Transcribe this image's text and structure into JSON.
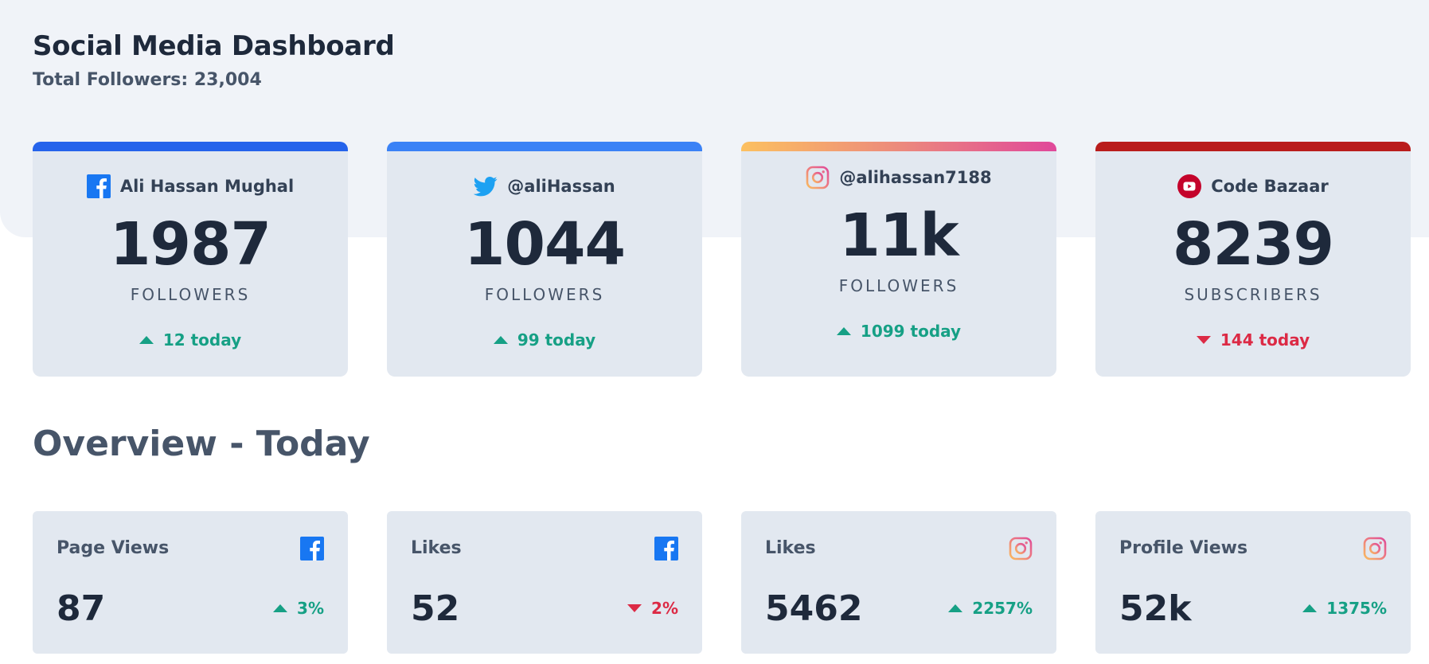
{
  "header": {
    "title": "Social Media Dashboard",
    "subtitle": "Total Followers: 23,004"
  },
  "colors": {
    "facebook": "#1877f2",
    "twitter": "#1da1f2",
    "youtube": "#c4032b",
    "up": "#16a085",
    "down": "#dc2a45"
  },
  "cards": [
    {
      "platform": "facebook",
      "icon": "facebook-icon",
      "handle": "Ali Hassan Mughal",
      "count": "1987",
      "label": "FOLLOWERS",
      "change": "12 today",
      "direction": "up"
    },
    {
      "platform": "twitter",
      "icon": "twitter-icon",
      "handle": "@aliHassan",
      "count": "1044",
      "label": "FOLLOWERS",
      "change": "99 today",
      "direction": "up"
    },
    {
      "platform": "instagram",
      "icon": "instagram-icon",
      "handle": "@alihassan7188",
      "count": "11k",
      "label": "FOLLOWERS",
      "change": "1099 today",
      "direction": "up"
    },
    {
      "platform": "youtube",
      "icon": "youtube-icon",
      "handle": "Code Bazaar",
      "count": "8239",
      "label": "SUBSCRIBERS",
      "change": "144 today",
      "direction": "down"
    }
  ],
  "overview": {
    "title": "Overview - Today",
    "stats": [
      {
        "title": "Page Views",
        "icon": "facebook-icon",
        "value": "87",
        "change": "3%",
        "direction": "up"
      },
      {
        "title": "Likes",
        "icon": "facebook-icon",
        "value": "52",
        "change": "2%",
        "direction": "down"
      },
      {
        "title": "Likes",
        "icon": "instagram-icon",
        "value": "5462",
        "change": "2257%",
        "direction": "up"
      },
      {
        "title": "Profile Views",
        "icon": "instagram-icon",
        "value": "52k",
        "change": "1375%",
        "direction": "up"
      }
    ]
  }
}
